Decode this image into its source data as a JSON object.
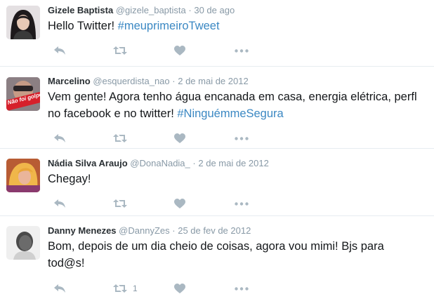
{
  "colors": {
    "link": "#3b88c3",
    "meta": "#8899a6",
    "icon": "#aab8c2"
  },
  "tweets": [
    {
      "name": "Gizele Baptista",
      "handle": "@gizele_baptista",
      "separator": "·",
      "time": "30 de ago",
      "text": "Hello Twitter! ",
      "hashtag": "#meuprimeiroTweet",
      "retweet_count": ""
    },
    {
      "name": "Marcelino",
      "handle": "@esquerdista_nao",
      "separator": "·",
      "time": "2 de mai de 2012",
      "text": "Vem gente! Agora tenho água encanada em casa, energia elétrica, perfl no facebook e no twitter! ",
      "hashtag": "#NinguémmeSegura",
      "avatar_badge": "Não foi golpe",
      "retweet_count": ""
    },
    {
      "name": "Nádia Silva Araujo",
      "handle": "@DonaNadia_",
      "separator": "·",
      "time": "2 de mai de 2012",
      "text": "Chegay!",
      "hashtag": "",
      "retweet_count": ""
    },
    {
      "name": "Danny Menezes",
      "handle": "@DannyZes",
      "separator": "·",
      "time": "25 de fev de 2012",
      "text": "Bom, depois de um dia cheio de coisas, agora vou mimi! Bjs para tod@s!",
      "hashtag": "",
      "retweet_count": "1"
    }
  ]
}
